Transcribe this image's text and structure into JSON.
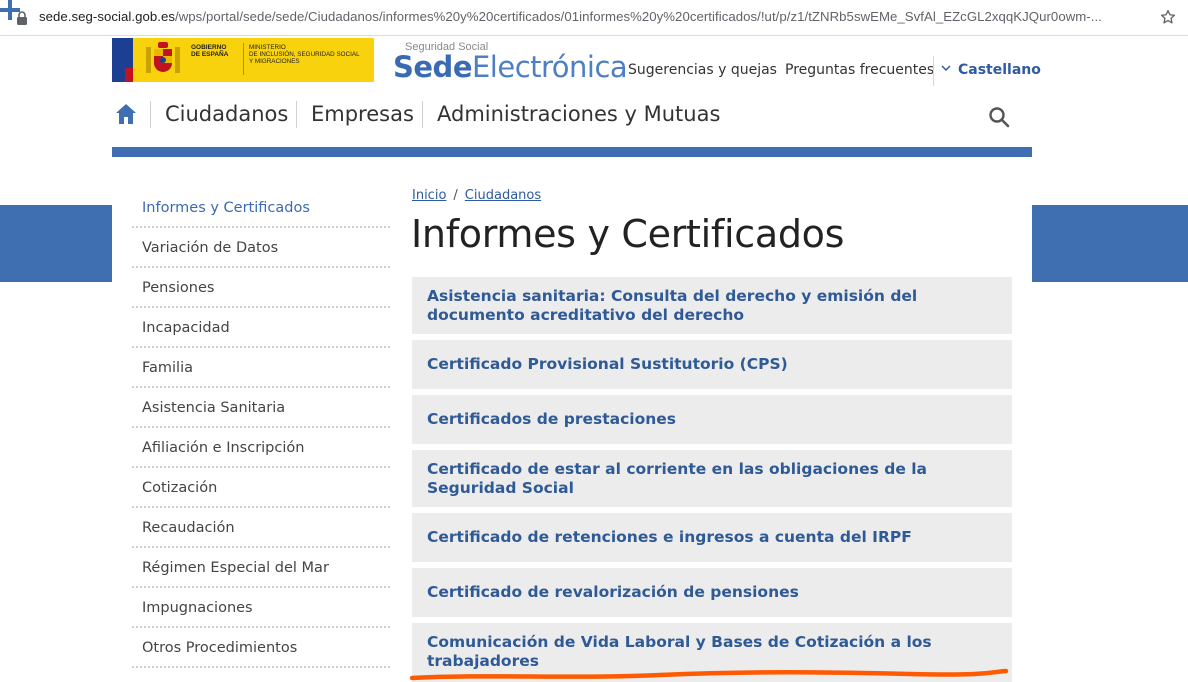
{
  "browser": {
    "url_host": "sede.seg-social.gob.es",
    "url_path": "/wps/portal/sede/sede/Ciudadanos/informes%20y%20certificados/01informes%20y%20certificados/!ut/p/z1/tZNRb5swEMe_SvfAl_EZcGL2xqqKJQur0owm-..."
  },
  "header": {
    "gov_text": "GOBIERNO\nDE ESPAÑA",
    "ministry_text": "MINISTERIO\nDE INCLUSIÓN, SEGURIDAD SOCIAL\nY MIGRACIONES",
    "brand_sub": "Seguridad Social",
    "brand_bold": "Sede",
    "brand_light": "Electrónica",
    "links": [
      "Sugerencias y quejas",
      "Preguntas frecuentes"
    ],
    "language": "Castellano"
  },
  "nav": {
    "items": [
      "Ciudadanos",
      "Empresas",
      "Administraciones y Mutuas"
    ]
  },
  "sidebar": {
    "items": [
      {
        "label": "Informes y Certificados",
        "active": true
      },
      {
        "label": "Variación de Datos"
      },
      {
        "label": "Pensiones"
      },
      {
        "label": "Incapacidad"
      },
      {
        "label": "Familia"
      },
      {
        "label": "Asistencia Sanitaria"
      },
      {
        "label": "Afiliación e Inscripción"
      },
      {
        "label": "Cotización"
      },
      {
        "label": "Recaudación"
      },
      {
        "label": "Régimen Especial del Mar"
      },
      {
        "label": "Impugnaciones"
      },
      {
        "label": "Otros Procedimientos"
      }
    ]
  },
  "breadcrumb": {
    "items": [
      "Inicio",
      "Ciudadanos"
    ],
    "separator": "/"
  },
  "main": {
    "title": "Informes y Certificados",
    "accordion": [
      "Asistencia sanitaria: Consulta del derecho y emisión del documento acreditativo del derecho",
      "Certificado Provisional Sustitutorio (CPS)",
      "Certificados de prestaciones",
      "Certificado de estar al corriente en las obligaciones de la Seguridad Social",
      "Certificado de retenciones e ingresos a cuenta del IRPF",
      "Certificado de revalorización de pensiones",
      "Comunicación de Vida Laboral y Bases de Cotización a los trabajadores"
    ]
  },
  "colors": {
    "brand_blue": "#3f6fb0",
    "link_blue": "#2d5aa0",
    "accordion_bg": "#ececec",
    "gov_yellow": "#f9d20e",
    "annotation_orange": "#ff5a00"
  }
}
